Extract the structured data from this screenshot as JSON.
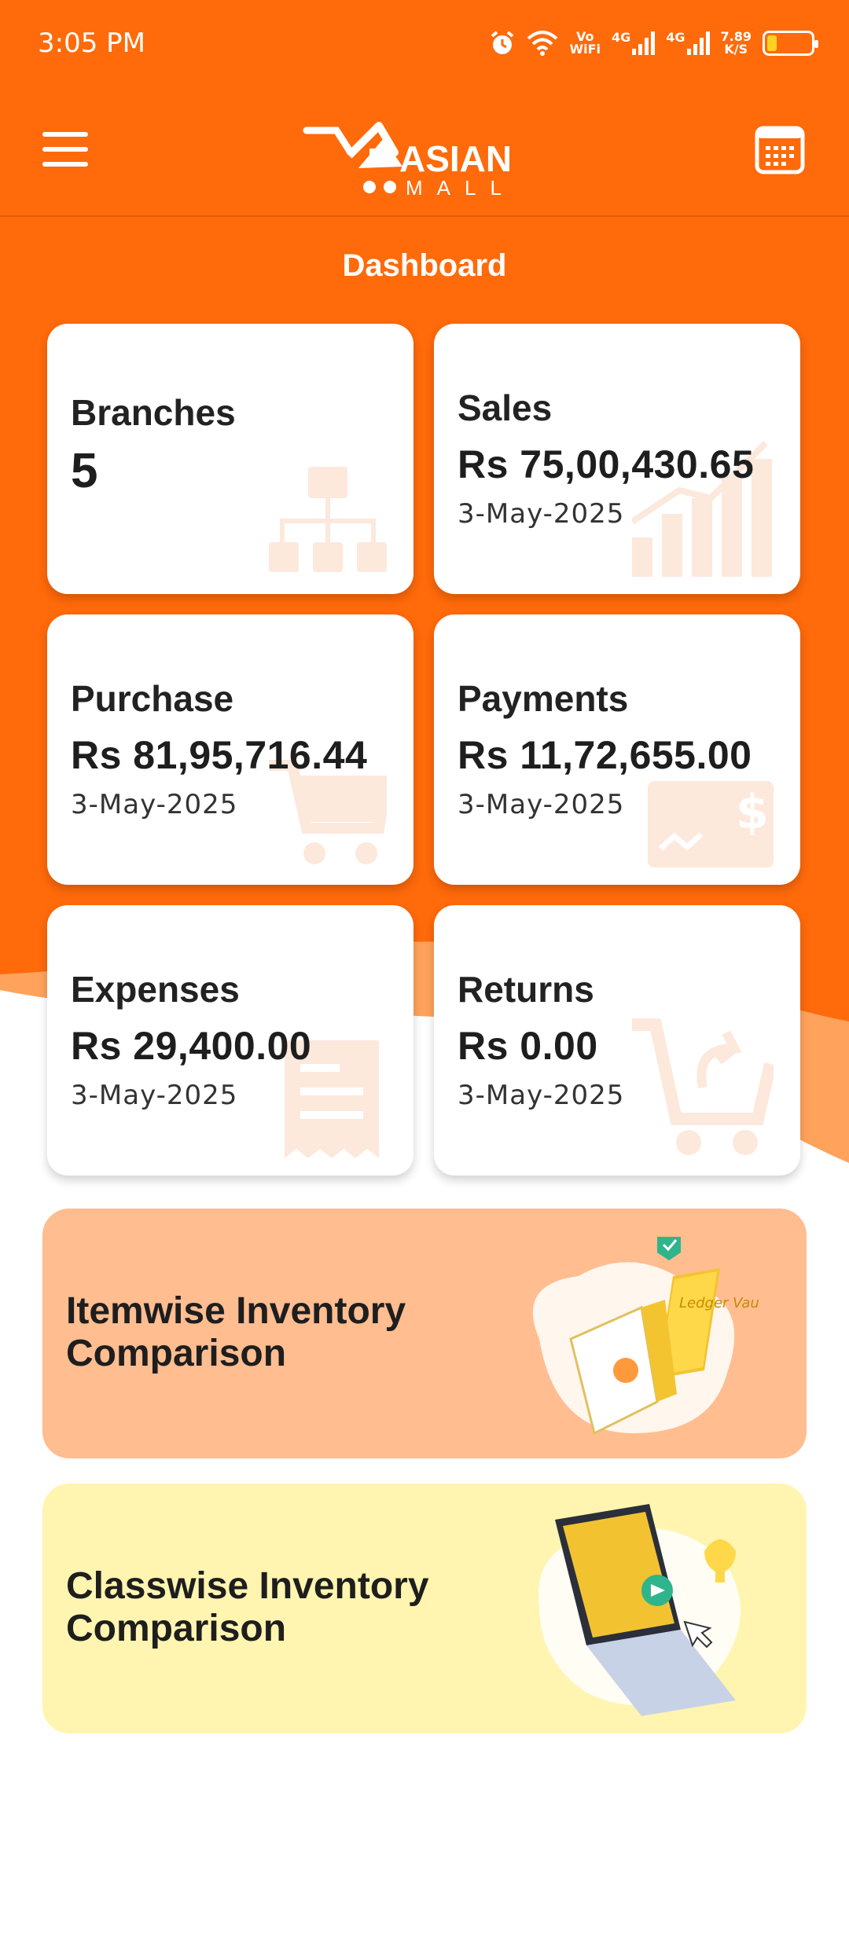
{
  "status_bar": {
    "time": "3:05 PM",
    "network_label_top": "Vo",
    "network_label_bottom": "WiFi",
    "sim1_label": "4G",
    "sim2_label": "4G",
    "speed_value": "7.89",
    "speed_unit": "K/S"
  },
  "app_bar": {
    "logo_text": "ASIAN",
    "logo_subtext": "MALL"
  },
  "page_title": "Dashboard",
  "cards": [
    {
      "title": "Branches",
      "value": "5",
      "date": ""
    },
    {
      "title": "Sales",
      "value": "Rs 75,00,430.65",
      "date": "3-May-2025"
    },
    {
      "title": "Purchase",
      "value": "Rs 81,95,716.44",
      "date": "3-May-2025"
    },
    {
      "title": "Payments",
      "value": "Rs 11,72,655.00",
      "date": "3-May-2025"
    },
    {
      "title": "Expenses",
      "value": "Rs 29,400.00",
      "date": "3-May-2025"
    },
    {
      "title": "Returns",
      "value": "Rs 0.00",
      "date": "3-May-2025"
    }
  ],
  "banners": [
    {
      "label_line1": "Itemwise Inventory",
      "label_line2": "Comparison",
      "art_book_text": "Ledger Vault"
    },
    {
      "label_line1": "Classwise Inventory",
      "label_line2": "Comparison"
    }
  ],
  "colors": {
    "brand_orange": "#ff6a0a",
    "wave_light": "#ffa35c",
    "banner1_bg": "#ffbd90",
    "banner2_bg": "#fff5b0",
    "watermark": "#fde8dc"
  },
  "icons": {
    "menu": "hamburger-menu-icon",
    "calendar": "calendar-icon",
    "branches": "org-chart-icon",
    "sales": "bar-chart-icon",
    "purchase": "cart-icon",
    "payments": "cheque-icon",
    "expenses": "receipt-icon",
    "returns": "cart-return-icon"
  }
}
